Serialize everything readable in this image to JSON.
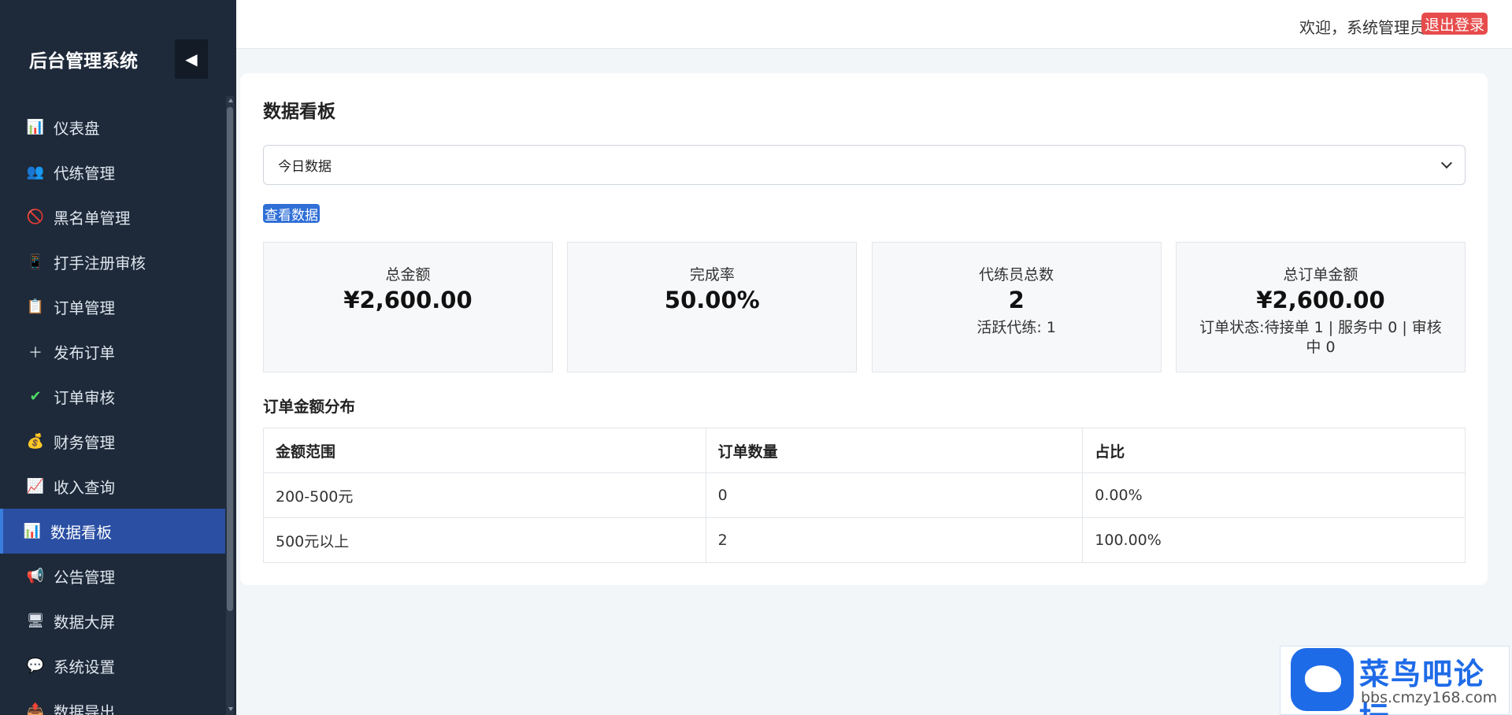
{
  "sidebar": {
    "brand": "后台管理系统",
    "collapse_icon": "◀",
    "items": [
      {
        "label": "仪表盘",
        "icon": "📊"
      },
      {
        "label": "代练管理",
        "icon": "👥"
      },
      {
        "label": "黑名单管理",
        "icon": "🚫"
      },
      {
        "label": "打手注册审核",
        "icon": "📱"
      },
      {
        "label": "订单管理",
        "icon": "📋"
      },
      {
        "label": "发布订单",
        "icon": "＋"
      },
      {
        "label": "订单审核",
        "icon": "✔"
      },
      {
        "label": "财务管理",
        "icon": "💰"
      },
      {
        "label": "收入查询",
        "icon": "📈"
      },
      {
        "label": "数据看板",
        "icon": "📊",
        "active": true
      },
      {
        "label": "公告管理",
        "icon": "📢"
      },
      {
        "label": "数据大屏",
        "icon": "🖥"
      },
      {
        "label": "系统设置",
        "icon": "💬"
      },
      {
        "label": "数据导出",
        "icon": "📤"
      }
    ]
  },
  "topbar": {
    "welcome": "欢迎，系统管理员",
    "logout_label": "退出登录"
  },
  "main": {
    "title": "数据看板",
    "period_select": {
      "selected": "今日数据"
    },
    "view_button": "查看数据",
    "stats": [
      {
        "label": "总金额",
        "value": "¥2,600.00",
        "sub": ""
      },
      {
        "label": "完成率",
        "value": "50.00%",
        "sub": ""
      },
      {
        "label": "代练员总数",
        "value": "2",
        "sub": "活跃代练: 1"
      },
      {
        "label": "总订单金额",
        "value": "¥2,600.00",
        "sub": "订单状态:待接单 1 | 服务中 0 | 审核中 0"
      }
    ],
    "distribution": {
      "title": "订单金额分布",
      "headers": [
        "金额范围",
        "订单数量",
        "占比"
      ],
      "rows": [
        [
          "200-500元",
          "0",
          "0.00%"
        ],
        [
          "500元以上",
          "2",
          "100.00%"
        ]
      ]
    }
  },
  "watermark": {
    "title": "菜鸟吧论坛",
    "url": "bbs.cmzy168.com"
  },
  "colors": {
    "sidebar_bg": "#1e2a3a",
    "active_item": "#2a4fa3",
    "logout": "#e74c4c",
    "primary": "#2f6fd6"
  }
}
